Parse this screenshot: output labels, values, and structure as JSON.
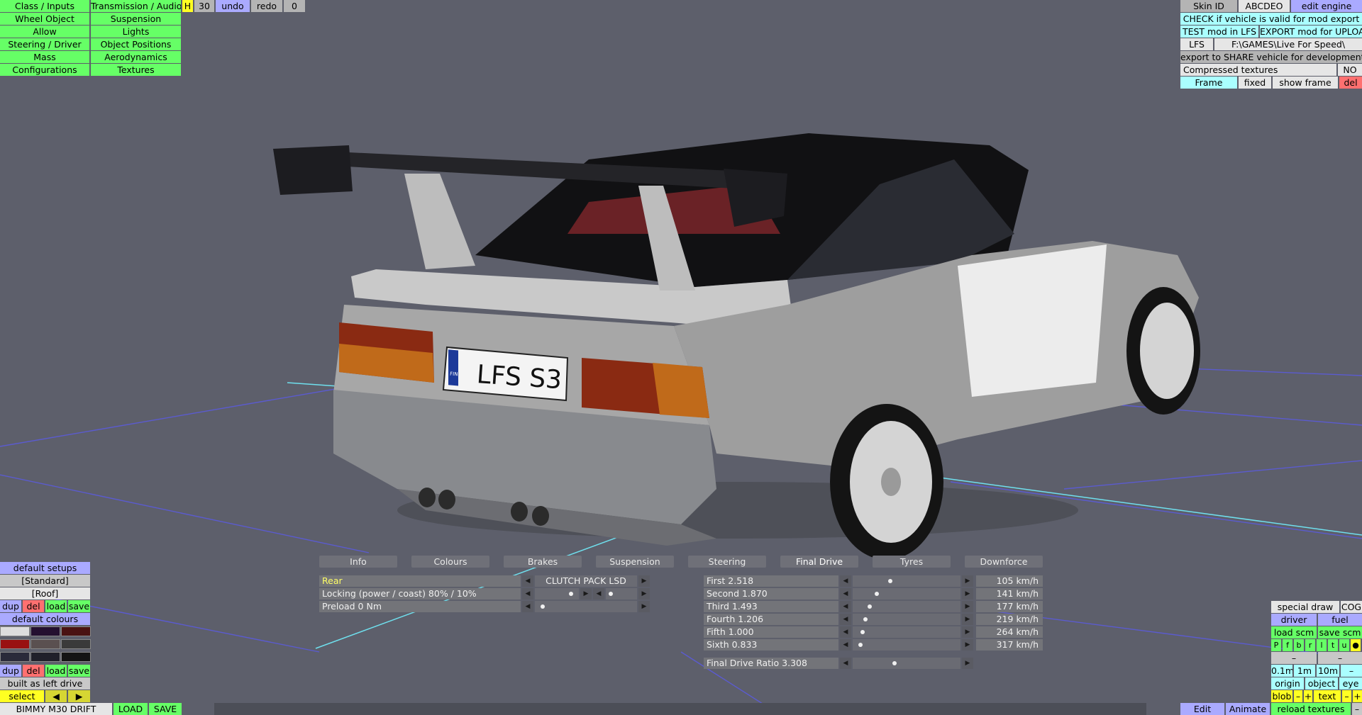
{
  "top_left_menu": [
    [
      "Class / Inputs",
      "Transmission / Audio"
    ],
    [
      "Wheel Object",
      "Suspension"
    ],
    [
      "Allow",
      "Lights"
    ],
    [
      "Steering / Driver",
      "Object Positions"
    ],
    [
      "Mass",
      "Aerodynamics"
    ],
    [
      "Configurations",
      "Textures"
    ]
  ],
  "top_bar": {
    "h": "H",
    "num": "30",
    "undo": "undo",
    "redo": "redo",
    "count": "0"
  },
  "top_right": {
    "skin_id": "Skin ID",
    "skin_value": "ABCDEO",
    "edit_engine": "edit engine",
    "check": "CHECK if vehicle is valid for mod export",
    "test": "TEST mod in LFS",
    "export": "EXPORT mod for UPLOAD",
    "lfs": "LFS",
    "path": "F:\\GAMES\\Live For Speed\\",
    "share": "export to SHARE vehicle for development",
    "compressed": "Compressed textures",
    "compressed_val": "NO",
    "frame": "Frame",
    "fixed": "fixed",
    "show_frame": "show frame",
    "del": "del"
  },
  "scene": {
    "plate": "LFS S3",
    "plate_country": "FIN"
  },
  "tabs": [
    "Info",
    "Colours",
    "Brakes",
    "Suspension",
    "Steering",
    "Final Drive",
    "Tyres",
    "Downforce"
  ],
  "active_tab": "Final Drive",
  "diff": {
    "axle": "Rear",
    "type": "CLUTCH PACK LSD",
    "locking": "Locking (power / coast) 80% / 10%",
    "preload": "Preload 0 Nm"
  },
  "gears": [
    {
      "label": "First 2.518",
      "speed": "105 km/h",
      "pos": 0.33
    },
    {
      "label": "Second 1.870",
      "speed": "141 km/h",
      "pos": 0.19
    },
    {
      "label": "Third 1.493",
      "speed": "177 km/h",
      "pos": 0.12
    },
    {
      "label": "Fourth 1.206",
      "speed": "219 km/h",
      "pos": 0.08
    },
    {
      "label": "Fifth 1.000",
      "speed": "264 km/h",
      "pos": 0.05
    },
    {
      "label": "Sixth 0.833",
      "speed": "317 km/h",
      "pos": 0.03
    }
  ],
  "final_drive": {
    "label": "Final Drive Ratio 3.308",
    "pos": 0.37
  },
  "left_panel": {
    "default_setups": "default setups",
    "standard": "[Standard]",
    "roof": "[Roof]",
    "dup": "dup",
    "del": "del",
    "load": "load",
    "save": "save",
    "default_colours": "default colours",
    "built_as": "built as left drive",
    "select": "select",
    "swatches": [
      "#dddddd",
      "#241030",
      "#4a1212",
      "#991111",
      "#5a5050",
      "#3a3a3a",
      "#2a2a3a",
      "#20202a",
      "#141414"
    ]
  },
  "bottom": {
    "car_name": "BIMMY M30 DRIFT",
    "load": "LOAD",
    "save": "SAVE"
  },
  "right_panel": {
    "special_draw": "special draw",
    "cog": "COG",
    "driver": "driver",
    "fuel": "fuel",
    "load_scm": "load scm",
    "save_scm": "save scm",
    "letters": [
      "P",
      "f",
      "b",
      "r",
      "l",
      "t",
      "u",
      "●"
    ],
    "dash1": "–",
    "dash2": "–",
    "scales": [
      "0.1m",
      "1m",
      "10m",
      "–"
    ],
    "origin": "origin",
    "object": "object",
    "eye": "eye",
    "blob": "blob",
    "minus": "–",
    "plus": "+",
    "text": "text",
    "minus2": "–",
    "plus2": "+",
    "edit": "Edit",
    "animate": "Animate",
    "reload": "reload textures",
    "minus3": "–"
  },
  "colors": {
    "green": "#66ff66",
    "blue": "#aaaaff",
    "cyan": "#aaffff",
    "red": "#ff7070",
    "yellow": "#ffff22"
  }
}
